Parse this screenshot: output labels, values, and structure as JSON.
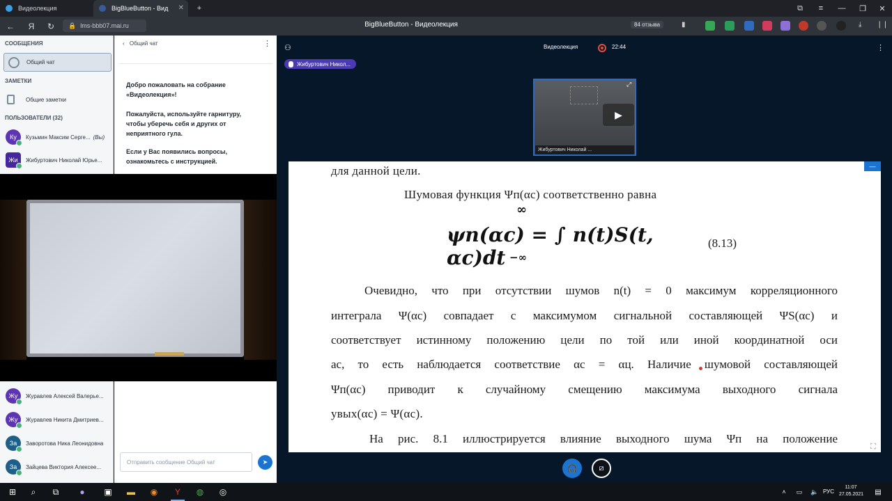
{
  "browser": {
    "tabs": [
      {
        "label": "Видеолекция",
        "active": false
      },
      {
        "label": "BigBlueButton - Вид",
        "active": true
      }
    ],
    "url": "lms-bbb07.mai.ru",
    "page_title": "BigBlueButton - Видеолекция",
    "reviews_badge": "84 отзыва"
  },
  "sidebar": {
    "messages_title": "СООБЩЕНИЯ",
    "public_chat_label": "Общий чат",
    "notes_title": "ЗАМЕТКИ",
    "shared_notes_label": "Общие заметки",
    "users_title": "ПОЛЬЗОВАТЕЛИ (32)",
    "users_top": [
      {
        "initials": "Ку",
        "name": "Кузьмин Максим Серге...",
        "suffix": "(Вы)",
        "color": "#5e35b1"
      },
      {
        "initials": "Жи",
        "name": "Жибуртович Николай Юрье...",
        "suffix": "",
        "color": "#4527a0"
      }
    ],
    "users_bottom": [
      {
        "initials": "Жу",
        "name": "Журавлев Алексей Валерье...",
        "color": "#5e35b1"
      },
      {
        "initials": "Жу",
        "name": "Журавлев Никита Дмитриев...",
        "color": "#5e35b1"
      },
      {
        "initials": "За",
        "name": "Заворотова Ника Леонидовна",
        "color": "#1e5f8a"
      },
      {
        "initials": "За",
        "name": "Зайцева Виктория Алексее...",
        "color": "#1e5f8a"
      }
    ]
  },
  "chat": {
    "header": "Общий чат",
    "welcome_1": "Добро пожаловать на собрание",
    "welcome_2": "«Видеолекция»!",
    "welcome_3": "Пожалуйста, используйте гарнитуру,",
    "welcome_4": "чтобы уберечь себя и других от",
    "welcome_5": "неприятного гула.",
    "welcome_6": "Если у Вас появились вопросы,",
    "welcome_7": "ознакомьтесь с инструкцией.",
    "input_placeholder": "Отправить сообщение Общий чат"
  },
  "meeting": {
    "title": "Видеолекция",
    "recording_time": "22:44",
    "talker": "Жибуртович Никол...",
    "video_name": "Жибуртович Николай ..."
  },
  "slide": {
    "line_top": "для  данной  цели.",
    "line_noise": "Шумовая  функция  Ψп(αс)  соответственно  равна",
    "formula": "ψn(αc) = ∫ n(t)S(t, αc)dt",
    "formula_upper": "∞",
    "formula_lower": "−∞",
    "formula_number": "(8.13)",
    "p1_l1": "Очевидно, что при отсутствии шумов n(t) = 0 максимум корреляционного",
    "p1_l2": "интеграла Ψ(αс) совпадает с максимумом сигнальной составляющей ΨS(αс) и",
    "p1_l3": "соответствует истинному положению цели по той или иной координатной оси",
    "p1_l4": "ас, то есть наблюдается соответствие αс = αц. Наличие шумовой составляющей",
    "p1_l5": "Ψп(αс) приводит к случайному смещению максимума выходного сигнала",
    "p1_l6": "yвых(αс) = Ψ(αс).",
    "p2_l1": "На  рис.  8.1  иллюстрируется  влияние  выходного  шума Ψп  на положение"
  },
  "taskbar": {
    "lang": "РУС",
    "time": "11:07",
    "date": "27.05.2021"
  }
}
